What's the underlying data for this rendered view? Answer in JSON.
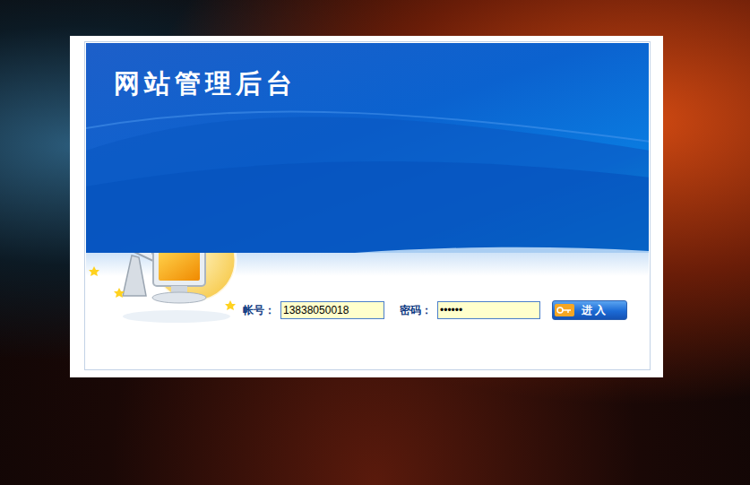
{
  "window": {
    "title": "网站管理后台"
  },
  "form": {
    "account": {
      "label": "帐号：",
      "value": "13838050018"
    },
    "password": {
      "label": "密码：",
      "value": "••••••"
    },
    "submit": {
      "label": "进 入"
    }
  }
}
